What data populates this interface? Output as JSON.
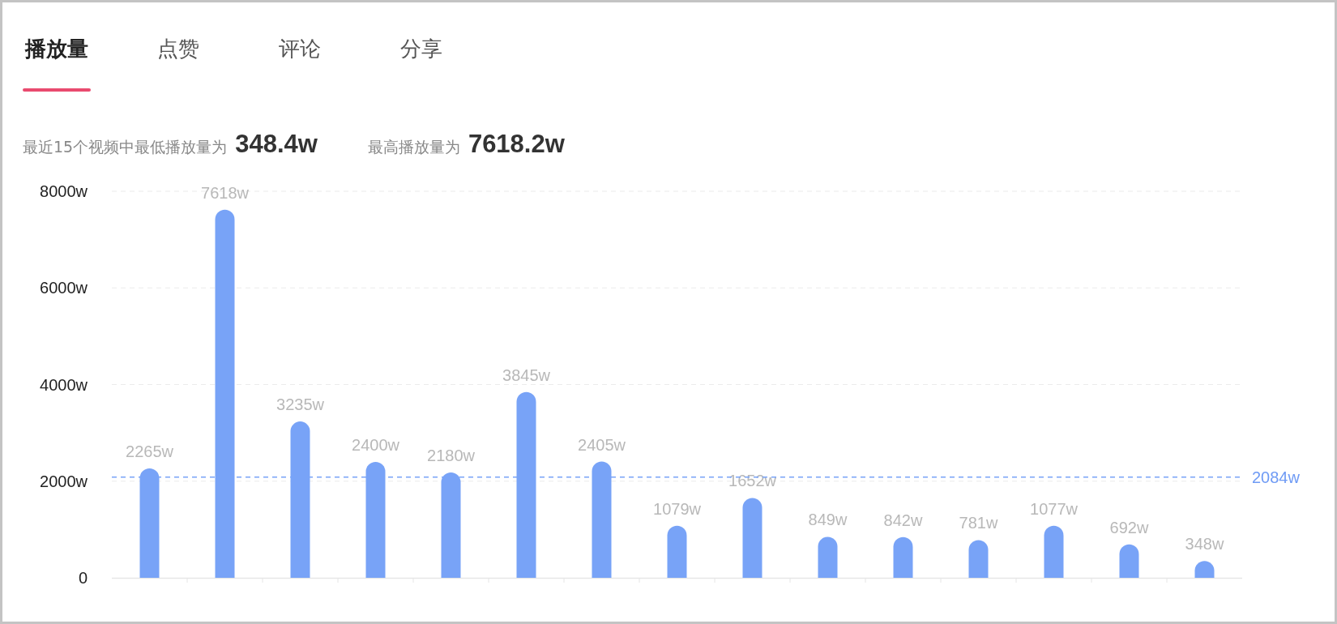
{
  "tabs": [
    {
      "label": "播放量",
      "selected": true
    },
    {
      "label": "点赞",
      "selected": false
    },
    {
      "label": "评论",
      "selected": false
    },
    {
      "label": "分享",
      "selected": false
    }
  ],
  "summary": {
    "min_label": "最近15个视频中最低播放量为",
    "min_value": "348.4w",
    "max_label": "最高播放量为",
    "max_value": "7618.2w"
  },
  "chart_data": {
    "type": "bar",
    "ylim": [
      0,
      8000
    ],
    "yticks": [
      {
        "value": 0,
        "label": "0"
      },
      {
        "value": 2000,
        "label": "2000w"
      },
      {
        "value": 4000,
        "label": "4000w"
      },
      {
        "value": 6000,
        "label": "6000w"
      },
      {
        "value": 8000,
        "label": "8000w"
      }
    ],
    "values": [
      2265,
      7618,
      3235,
      2400,
      2180,
      3845,
      2405,
      1079,
      1652,
      849,
      842,
      781,
      1077,
      692,
      348
    ],
    "value_labels": [
      "2265w",
      "7618w",
      "3235w",
      "2400w",
      "2180w",
      "3845w",
      "2405w",
      "1079w",
      "1652w",
      "849w",
      "842w",
      "781w",
      "1077w",
      "692w",
      "348w"
    ],
    "grid": true,
    "ref_lines": [
      {
        "axis": "y",
        "value": 2084,
        "label": "2084w"
      }
    ]
  }
}
